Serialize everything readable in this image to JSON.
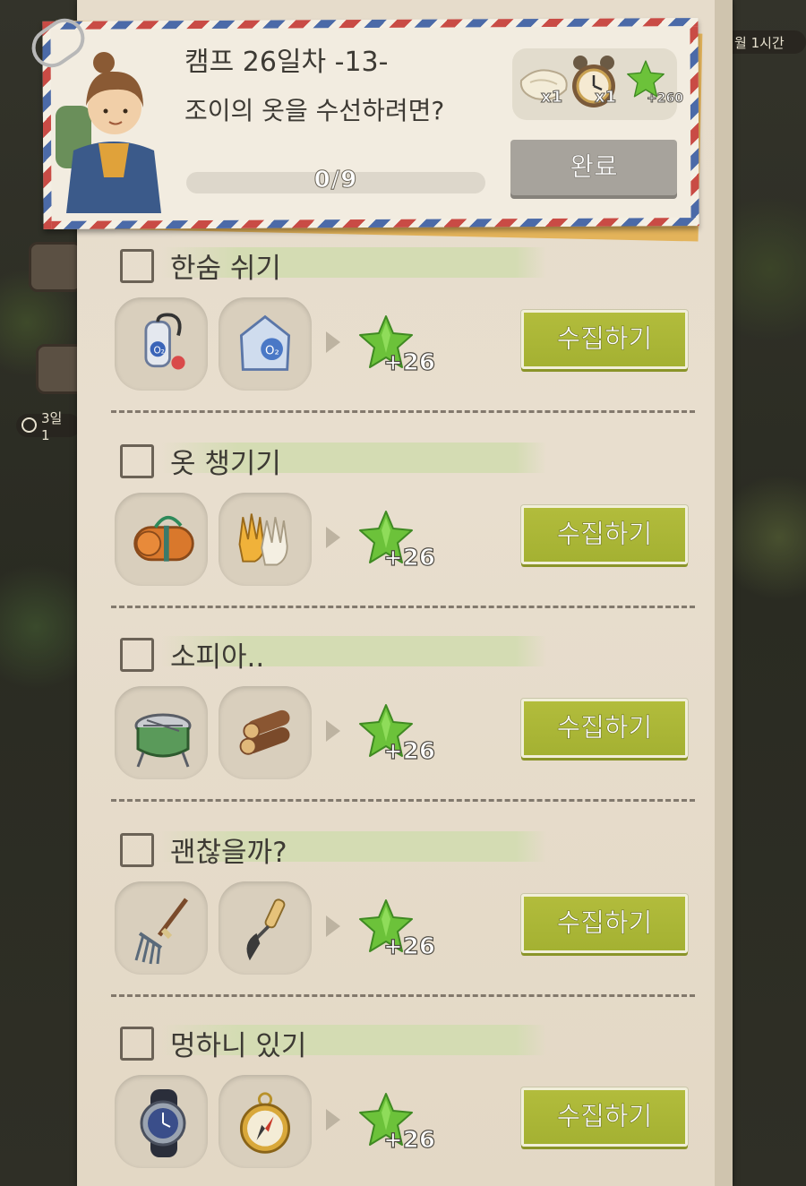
{
  "quest": {
    "title": "캠프 26일차 -13-",
    "subtitle": "조이의 옷을 수선하려면?",
    "progress_text": "0/9",
    "progress_value": 0,
    "done_label": "완료",
    "rewards": [
      {
        "icon": "cloth-icon",
        "count": "x1"
      },
      {
        "icon": "alarm-clock-icon",
        "count": "x1"
      },
      {
        "icon": "green-star-icon",
        "count": "+260"
      }
    ]
  },
  "side": {
    "timer_top": "월 1시간",
    "timer_left": "3일 1"
  },
  "tasks": [
    {
      "title": "한숨 쉬기",
      "items": [
        "oxygen-tank-icon",
        "oxygen-bag-icon"
      ],
      "reward": "+26",
      "button": "수집하기"
    },
    {
      "title": "옷 챙기기",
      "items": [
        "sleeping-mat-icon",
        "gloves-icon"
      ],
      "reward": "+26",
      "button": "수집하기"
    },
    {
      "title": "소피아..",
      "items": [
        "grill-icon",
        "firewood-icon"
      ],
      "reward": "+26",
      "button": "수집하기"
    },
    {
      "title": "괜찮을까?",
      "items": [
        "rake-icon",
        "hoe-icon"
      ],
      "reward": "+26",
      "button": "수집하기"
    },
    {
      "title": "멍하니 있기",
      "items": [
        "wristwatch-icon",
        "compass-icon"
      ],
      "reward": "+26",
      "button": "수집하기"
    }
  ],
  "colors": {
    "collect_green": "#a9b536",
    "star_green": "#6cc23a",
    "envelope_red": "#c94b45",
    "envelope_blue": "#4b6aa8"
  }
}
